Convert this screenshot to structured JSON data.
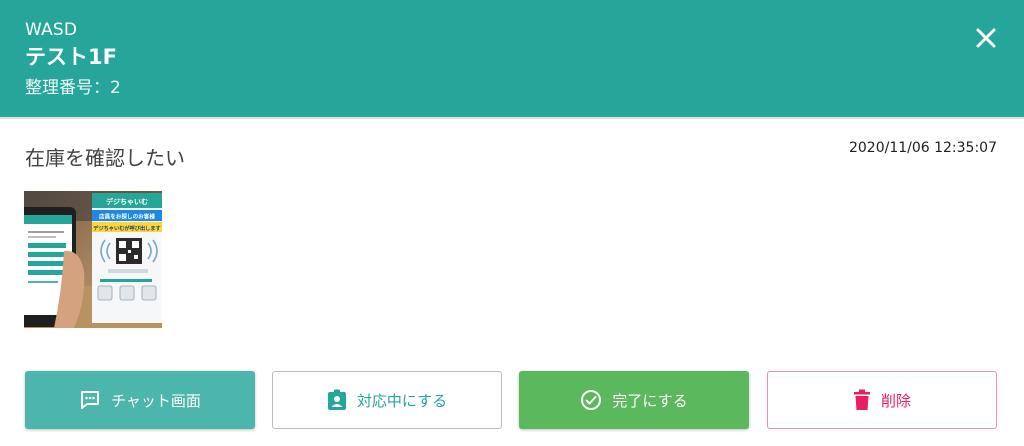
{
  "header": {
    "store_name": "WASD",
    "table_name": "テスト1F",
    "ref_number": "整理番号：2"
  },
  "request": {
    "message": "在庫を確認したい",
    "timestamp": "2020/11/06 12:35:07"
  },
  "photo": {
    "brand": "デジちゃいむ",
    "headline_1": "店員をお探しのお客様",
    "headline_2": "デジちゃいむが呼び出します"
  },
  "actions": {
    "chat": "チャット画面",
    "in_progress": "対応中にする",
    "complete": "完了にする",
    "delete": "削除"
  },
  "colors": {
    "header_bg": "#26a69a",
    "chat_bg": "#4db6ac",
    "complete_bg": "#5cb85c",
    "delete_accent": "#e91e63"
  }
}
